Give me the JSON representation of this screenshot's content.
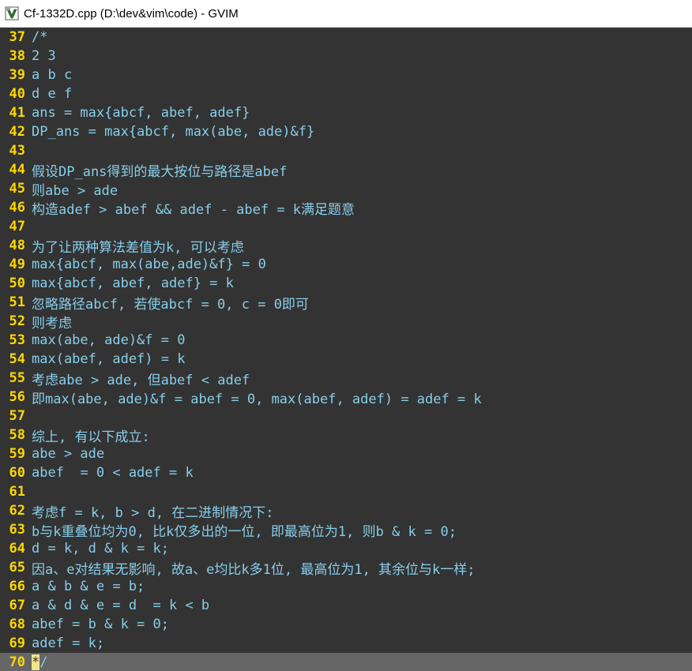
{
  "window": {
    "title": "Cf-1332D.cpp (D:\\dev&vim\\code) - GVIM",
    "icon": "gvim-icon"
  },
  "editor": {
    "lines": [
      {
        "num": "37",
        "text": "/*"
      },
      {
        "num": "38",
        "text": "2 3"
      },
      {
        "num": "39",
        "text": "a b c"
      },
      {
        "num": "40",
        "text": "d e f"
      },
      {
        "num": "41",
        "text": "ans = max{abcf, abef, adef}"
      },
      {
        "num": "42",
        "text": "DP_ans = max{abcf, max(abe, ade)&f}"
      },
      {
        "num": "43",
        "text": ""
      },
      {
        "num": "44",
        "text": "假设DP_ans得到的最大按位与路径是abef"
      },
      {
        "num": "45",
        "text": "则abe > ade"
      },
      {
        "num": "46",
        "text": "构造adef > abef && adef - abef = k满足题意"
      },
      {
        "num": "47",
        "text": ""
      },
      {
        "num": "48",
        "text": "为了让两种算法差值为k, 可以考虑"
      },
      {
        "num": "49",
        "text": "max{abcf, max(abe,ade)&f} = 0"
      },
      {
        "num": "50",
        "text": "max{abcf, abef, adef} = k"
      },
      {
        "num": "51",
        "text": "忽略路径abcf, 若使abcf = 0, c = 0即可"
      },
      {
        "num": "52",
        "text": "则考虑"
      },
      {
        "num": "53",
        "text": "max(abe, ade)&f = 0"
      },
      {
        "num": "54",
        "text": "max(abef, adef) = k"
      },
      {
        "num": "55",
        "text": "考虑abe > ade, 但abef < adef"
      },
      {
        "num": "56",
        "text": "即max(abe, ade)&f = abef = 0, max(abef, adef) = adef = k"
      },
      {
        "num": "57",
        "text": ""
      },
      {
        "num": "58",
        "text": "综上, 有以下成立:"
      },
      {
        "num": "59",
        "text": "abe > ade"
      },
      {
        "num": "60",
        "text": "abef  = 0 < adef = k"
      },
      {
        "num": "61",
        "text": ""
      },
      {
        "num": "62",
        "text": "考虑f = k, b > d, 在二进制情况下:"
      },
      {
        "num": "63",
        "text": "b与k重叠位均为0, 比k仅多出的一位, 即最高位为1, 则b & k = 0;"
      },
      {
        "num": "64",
        "text": "d = k, d & k = k;"
      },
      {
        "num": "65",
        "text": "因a、e对结果无影响, 故a、e均比k多1位, 最高位为1, 其余位与k一样;"
      },
      {
        "num": "66",
        "text": "a & b & e = b;"
      },
      {
        "num": "67",
        "text": "a & d & e = d  = k < b"
      },
      {
        "num": "68",
        "text": "abef = b & k = 0;"
      },
      {
        "num": "69",
        "text": "adef = k;"
      }
    ],
    "last_line": {
      "num": "70",
      "cursor_char": "*",
      "rest": "/"
    }
  },
  "colors": {
    "background": "#333333",
    "line_number": "#ffd700",
    "text": "#87ceeb",
    "cursor_line": "#666666",
    "cursor": "#f0e68c"
  }
}
